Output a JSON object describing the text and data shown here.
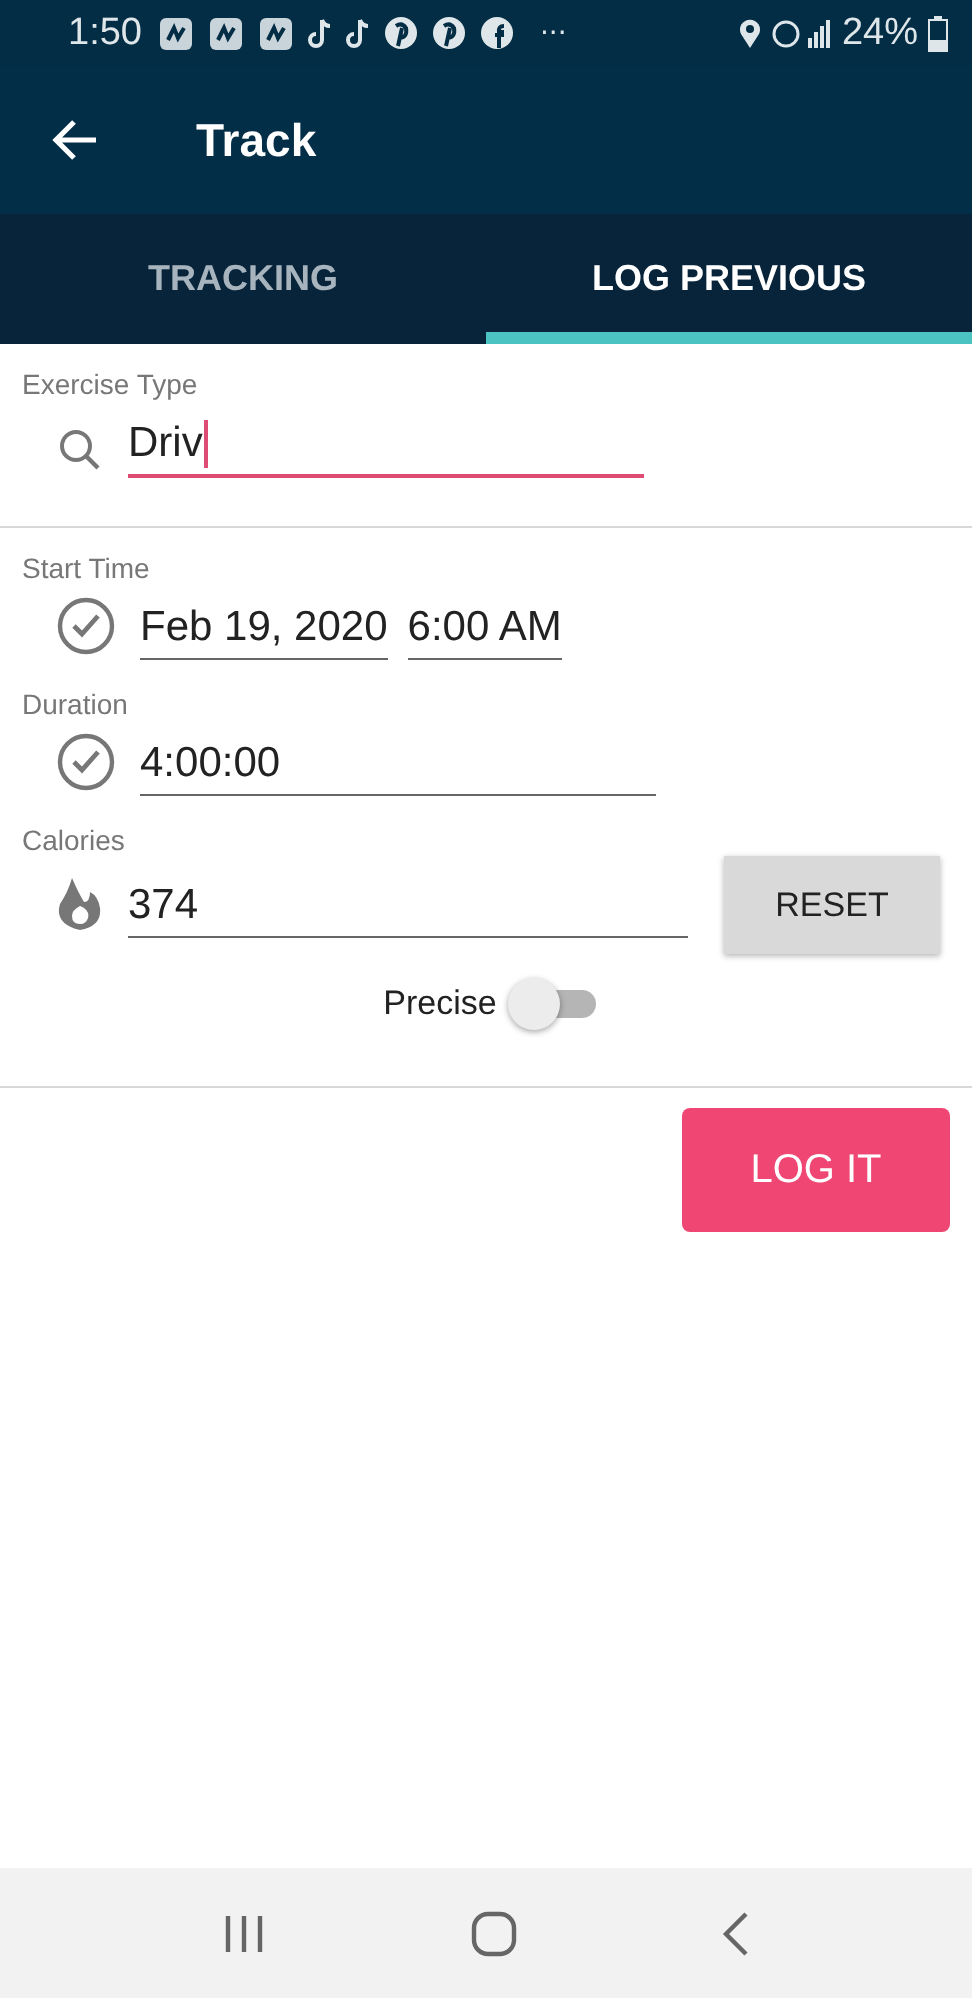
{
  "status_bar": {
    "time": "1:50",
    "more": "···",
    "battery": "24%"
  },
  "app_bar": {
    "title": "Track"
  },
  "tabs": [
    {
      "label": "TRACKING",
      "selected": false
    },
    {
      "label": "LOG PREVIOUS",
      "selected": true
    }
  ],
  "exercise": {
    "label": "Exercise Type",
    "value": "Driv",
    "focused": true
  },
  "start_time": {
    "label": "Start Time",
    "date": "Feb 19, 2020",
    "time": "6:00 AM"
  },
  "duration": {
    "label": "Duration",
    "value": "4:00:00"
  },
  "calories": {
    "label": "Calories",
    "value": "374",
    "button": "RESET"
  },
  "precise": {
    "label": "Precise",
    "on": false
  },
  "log_button": "LOG IT"
}
